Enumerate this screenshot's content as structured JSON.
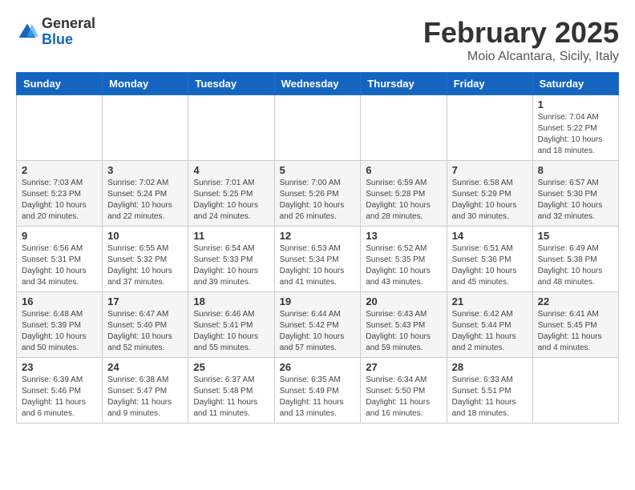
{
  "header": {
    "logo_general": "General",
    "logo_blue": "Blue",
    "title": "February 2025",
    "subtitle": "Moio Alcantara, Sicily, Italy"
  },
  "weekdays": [
    "Sunday",
    "Monday",
    "Tuesday",
    "Wednesday",
    "Thursday",
    "Friday",
    "Saturday"
  ],
  "weeks": [
    [
      {
        "day": "",
        "info": ""
      },
      {
        "day": "",
        "info": ""
      },
      {
        "day": "",
        "info": ""
      },
      {
        "day": "",
        "info": ""
      },
      {
        "day": "",
        "info": ""
      },
      {
        "day": "",
        "info": ""
      },
      {
        "day": "1",
        "info": "Sunrise: 7:04 AM\nSunset: 5:22 PM\nDaylight: 10 hours\nand 18 minutes."
      }
    ],
    [
      {
        "day": "2",
        "info": "Sunrise: 7:03 AM\nSunset: 5:23 PM\nDaylight: 10 hours\nand 20 minutes."
      },
      {
        "day": "3",
        "info": "Sunrise: 7:02 AM\nSunset: 5:24 PM\nDaylight: 10 hours\nand 22 minutes."
      },
      {
        "day": "4",
        "info": "Sunrise: 7:01 AM\nSunset: 5:25 PM\nDaylight: 10 hours\nand 24 minutes."
      },
      {
        "day": "5",
        "info": "Sunrise: 7:00 AM\nSunset: 5:26 PM\nDaylight: 10 hours\nand 26 minutes."
      },
      {
        "day": "6",
        "info": "Sunrise: 6:59 AM\nSunset: 5:28 PM\nDaylight: 10 hours\nand 28 minutes."
      },
      {
        "day": "7",
        "info": "Sunrise: 6:58 AM\nSunset: 5:29 PM\nDaylight: 10 hours\nand 30 minutes."
      },
      {
        "day": "8",
        "info": "Sunrise: 6:57 AM\nSunset: 5:30 PM\nDaylight: 10 hours\nand 32 minutes."
      }
    ],
    [
      {
        "day": "9",
        "info": "Sunrise: 6:56 AM\nSunset: 5:31 PM\nDaylight: 10 hours\nand 34 minutes."
      },
      {
        "day": "10",
        "info": "Sunrise: 6:55 AM\nSunset: 5:32 PM\nDaylight: 10 hours\nand 37 minutes."
      },
      {
        "day": "11",
        "info": "Sunrise: 6:54 AM\nSunset: 5:33 PM\nDaylight: 10 hours\nand 39 minutes."
      },
      {
        "day": "12",
        "info": "Sunrise: 6:53 AM\nSunset: 5:34 PM\nDaylight: 10 hours\nand 41 minutes."
      },
      {
        "day": "13",
        "info": "Sunrise: 6:52 AM\nSunset: 5:35 PM\nDaylight: 10 hours\nand 43 minutes."
      },
      {
        "day": "14",
        "info": "Sunrise: 6:51 AM\nSunset: 5:36 PM\nDaylight: 10 hours\nand 45 minutes."
      },
      {
        "day": "15",
        "info": "Sunrise: 6:49 AM\nSunset: 5:38 PM\nDaylight: 10 hours\nand 48 minutes."
      }
    ],
    [
      {
        "day": "16",
        "info": "Sunrise: 6:48 AM\nSunset: 5:39 PM\nDaylight: 10 hours\nand 50 minutes."
      },
      {
        "day": "17",
        "info": "Sunrise: 6:47 AM\nSunset: 5:40 PM\nDaylight: 10 hours\nand 52 minutes."
      },
      {
        "day": "18",
        "info": "Sunrise: 6:46 AM\nSunset: 5:41 PM\nDaylight: 10 hours\nand 55 minutes."
      },
      {
        "day": "19",
        "info": "Sunrise: 6:44 AM\nSunset: 5:42 PM\nDaylight: 10 hours\nand 57 minutes."
      },
      {
        "day": "20",
        "info": "Sunrise: 6:43 AM\nSunset: 5:43 PM\nDaylight: 10 hours\nand 59 minutes."
      },
      {
        "day": "21",
        "info": "Sunrise: 6:42 AM\nSunset: 5:44 PM\nDaylight: 11 hours\nand 2 minutes."
      },
      {
        "day": "22",
        "info": "Sunrise: 6:41 AM\nSunset: 5:45 PM\nDaylight: 11 hours\nand 4 minutes."
      }
    ],
    [
      {
        "day": "23",
        "info": "Sunrise: 6:39 AM\nSunset: 5:46 PM\nDaylight: 11 hours\nand 6 minutes."
      },
      {
        "day": "24",
        "info": "Sunrise: 6:38 AM\nSunset: 5:47 PM\nDaylight: 11 hours\nand 9 minutes."
      },
      {
        "day": "25",
        "info": "Sunrise: 6:37 AM\nSunset: 5:48 PM\nDaylight: 11 hours\nand 11 minutes."
      },
      {
        "day": "26",
        "info": "Sunrise: 6:35 AM\nSunset: 5:49 PM\nDaylight: 11 hours\nand 13 minutes."
      },
      {
        "day": "27",
        "info": "Sunrise: 6:34 AM\nSunset: 5:50 PM\nDaylight: 11 hours\nand 16 minutes."
      },
      {
        "day": "28",
        "info": "Sunrise: 6:33 AM\nSunset: 5:51 PM\nDaylight: 11 hours\nand 18 minutes."
      },
      {
        "day": "",
        "info": ""
      }
    ]
  ]
}
